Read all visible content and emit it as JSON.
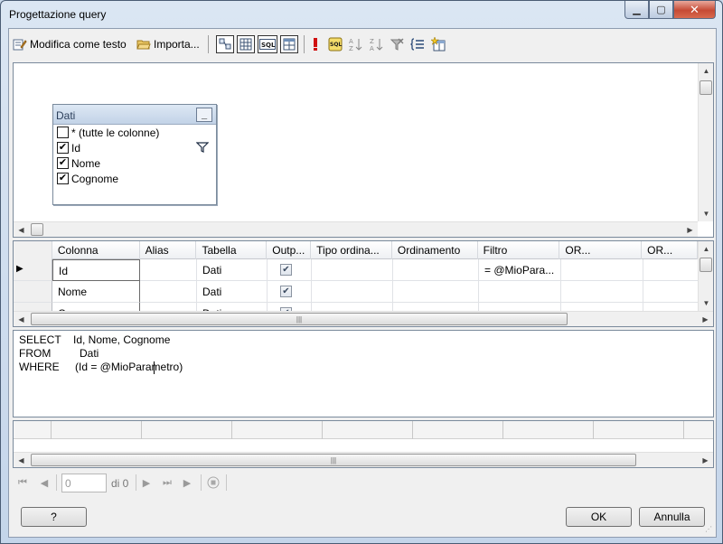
{
  "window": {
    "title": "Progettazione query",
    "minimize_glyph": "▁",
    "maximize_glyph": "▢",
    "close_glyph": "✕"
  },
  "toolbar": {
    "edit_as_text_label": "Modifica come testo",
    "import_label": "Importa..."
  },
  "diagram": {
    "table_name": "Dati",
    "minimize_glyph": "_",
    "columns": [
      {
        "label": "* (tutte le colonne)",
        "checked": false
      },
      {
        "label": "Id",
        "checked": true,
        "filtered": true
      },
      {
        "label": "Nome",
        "checked": true
      },
      {
        "label": "Cognome",
        "checked": true
      }
    ],
    "check_glyph": "✔"
  },
  "grid": {
    "headers": [
      "Colonna",
      "Alias",
      "Tabella",
      "Outp...",
      "Tipo ordina...",
      "Ordinamento",
      "Filtro",
      "OR...",
      "OR..."
    ],
    "rows": [
      {
        "Colonna": "Id",
        "Alias": "",
        "Tabella": "Dati",
        "Output": true,
        "Filtro": "= @MioPara..."
      },
      {
        "Colonna": "Nome",
        "Alias": "",
        "Tabella": "Dati",
        "Output": true,
        "Filtro": ""
      },
      {
        "Colonna": "Cognome",
        "Alias": "",
        "Tabella": "Dati",
        "Output": true,
        "Filtro": ""
      }
    ],
    "current_row_glyph": "▶"
  },
  "sql": {
    "lines": [
      {
        "keyword": "SELECT",
        "text": "Id, Nome, Cognome"
      },
      {
        "keyword": "FROM",
        "text": "Dati"
      },
      {
        "keyword": "WHERE",
        "text": "(Id = @MioParametro)"
      }
    ]
  },
  "navigator": {
    "current_value": "0",
    "of_label": "di 0"
  },
  "buttons": {
    "help_label": "?",
    "ok_label": "OK",
    "cancel_label": "Annulla"
  },
  "colors": {
    "title_gradient_top": "#dbe6f3",
    "close_red": "#c64a35",
    "diagram_header": "#c2d3e7"
  }
}
